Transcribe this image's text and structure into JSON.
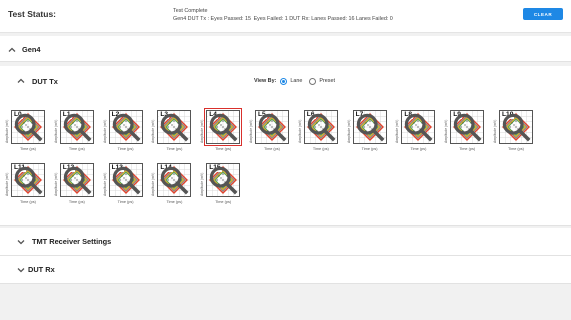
{
  "status": {
    "label": "Test Status:",
    "line1": "Test Complete",
    "line2": "Gen4   DUT Tx : Eyes Passed: 15  Eyes Failed: 1     DUT Rx: Lanes Passed: 16    Lanes Failed: 0",
    "clear_label": "CLEAR"
  },
  "sections": {
    "gen4": {
      "title": "Gen4"
    },
    "dut_tx": {
      "title": "DUT Tx"
    },
    "tmt": {
      "title": "TMT Receiver Settings"
    },
    "dut_rx": {
      "title": "DUT Rx"
    }
  },
  "view_by": {
    "label": "View By:",
    "options": [
      "Lane",
      "Preset"
    ],
    "selected": "Lane"
  },
  "axis": {
    "ylabel": "Amplitude (mV)",
    "xlabel": "Time (ps)"
  },
  "lanes": [
    {
      "label": "L0",
      "selected": false
    },
    {
      "label": "L1",
      "selected": false
    },
    {
      "label": "L2",
      "selected": false
    },
    {
      "label": "L3",
      "selected": false
    },
    {
      "label": "L4",
      "selected": true
    },
    {
      "label": "L5",
      "selected": false
    },
    {
      "label": "L6",
      "selected": false
    },
    {
      "label": "L7",
      "selected": false
    },
    {
      "label": "L8",
      "selected": false
    },
    {
      "label": "L9",
      "selected": false
    },
    {
      "label": "L10",
      "selected": false
    },
    {
      "label": "L11",
      "selected": false
    },
    {
      "label": "L12",
      "selected": false
    },
    {
      "label": "L13",
      "selected": false
    },
    {
      "label": "L14",
      "selected": false
    },
    {
      "label": "L15",
      "selected": false
    }
  ],
  "colors": {
    "accent": "#1e88e5",
    "selected_outline": "#d9302c"
  }
}
